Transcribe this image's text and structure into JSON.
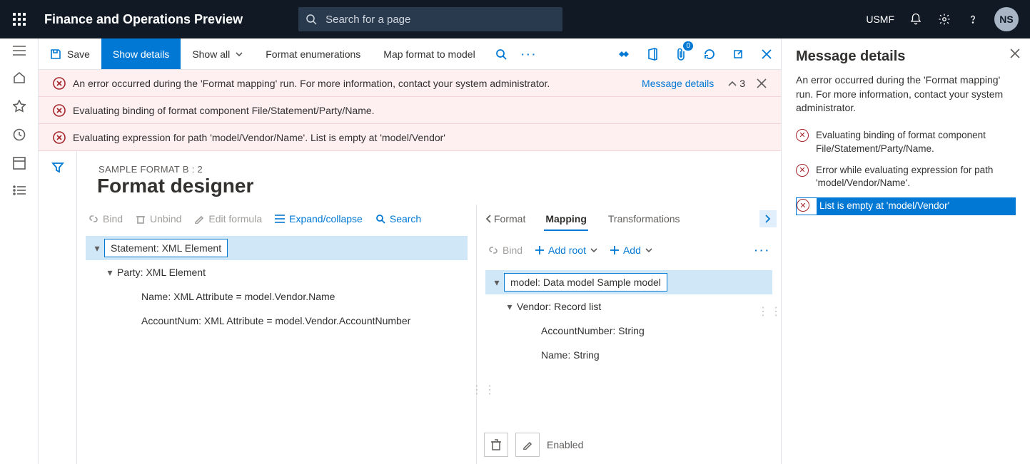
{
  "topbar": {
    "title": "Finance and Operations Preview",
    "search_placeholder": "Search for a page",
    "entity": "USMF",
    "avatar": "NS"
  },
  "actionbar": {
    "save": "Save",
    "show_details": "Show details",
    "show_all": "Show all",
    "format_enum": "Format enumerations",
    "map_format": "Map format to model",
    "badge": "0"
  },
  "errors": {
    "e1": "An error occurred during the 'Format mapping' run. For more information, contact your system administrator.",
    "e2": "Evaluating binding of format component File/Statement/Party/Name.",
    "e3": "Evaluating expression for path 'model/Vendor/Name'.   List is empty at 'model/Vendor'",
    "details_link": "Message details",
    "count": "3"
  },
  "page": {
    "breadcrumb": "SAMPLE FORMAT B : 2",
    "title": "Format designer"
  },
  "leftpane": {
    "bind": "Bind",
    "unbind": "Unbind",
    "edit_formula": "Edit formula",
    "expand": "Expand/collapse",
    "search": "Search",
    "tree": {
      "n1": "Statement: XML Element",
      "n2": "Party: XML Element",
      "n3": "Name: XML Attribute = model.Vendor.Name",
      "n4": "AccountNum: XML Attribute = model.Vendor.AccountNumber"
    }
  },
  "rightpane": {
    "back": "Format",
    "tab_mapping": "Mapping",
    "tab_trans": "Transformations",
    "bind": "Bind",
    "add_root": "Add root",
    "add": "Add",
    "tree": {
      "n1": "model: Data model Sample model",
      "n2": "Vendor: Record list",
      "n3": "AccountNumber: String",
      "n4": "Name: String"
    },
    "enabled": "Enabled"
  },
  "panel": {
    "title": "Message details",
    "desc": "An error occurred during the 'Format mapping' run. For more information, contact your system administrator.",
    "m1": "Evaluating binding of format component File/Statement/Party/Name.",
    "m2": "Error while evaluating expression for path 'model/Vendor/Name'.",
    "m3": "List is empty at 'model/Vendor'"
  }
}
